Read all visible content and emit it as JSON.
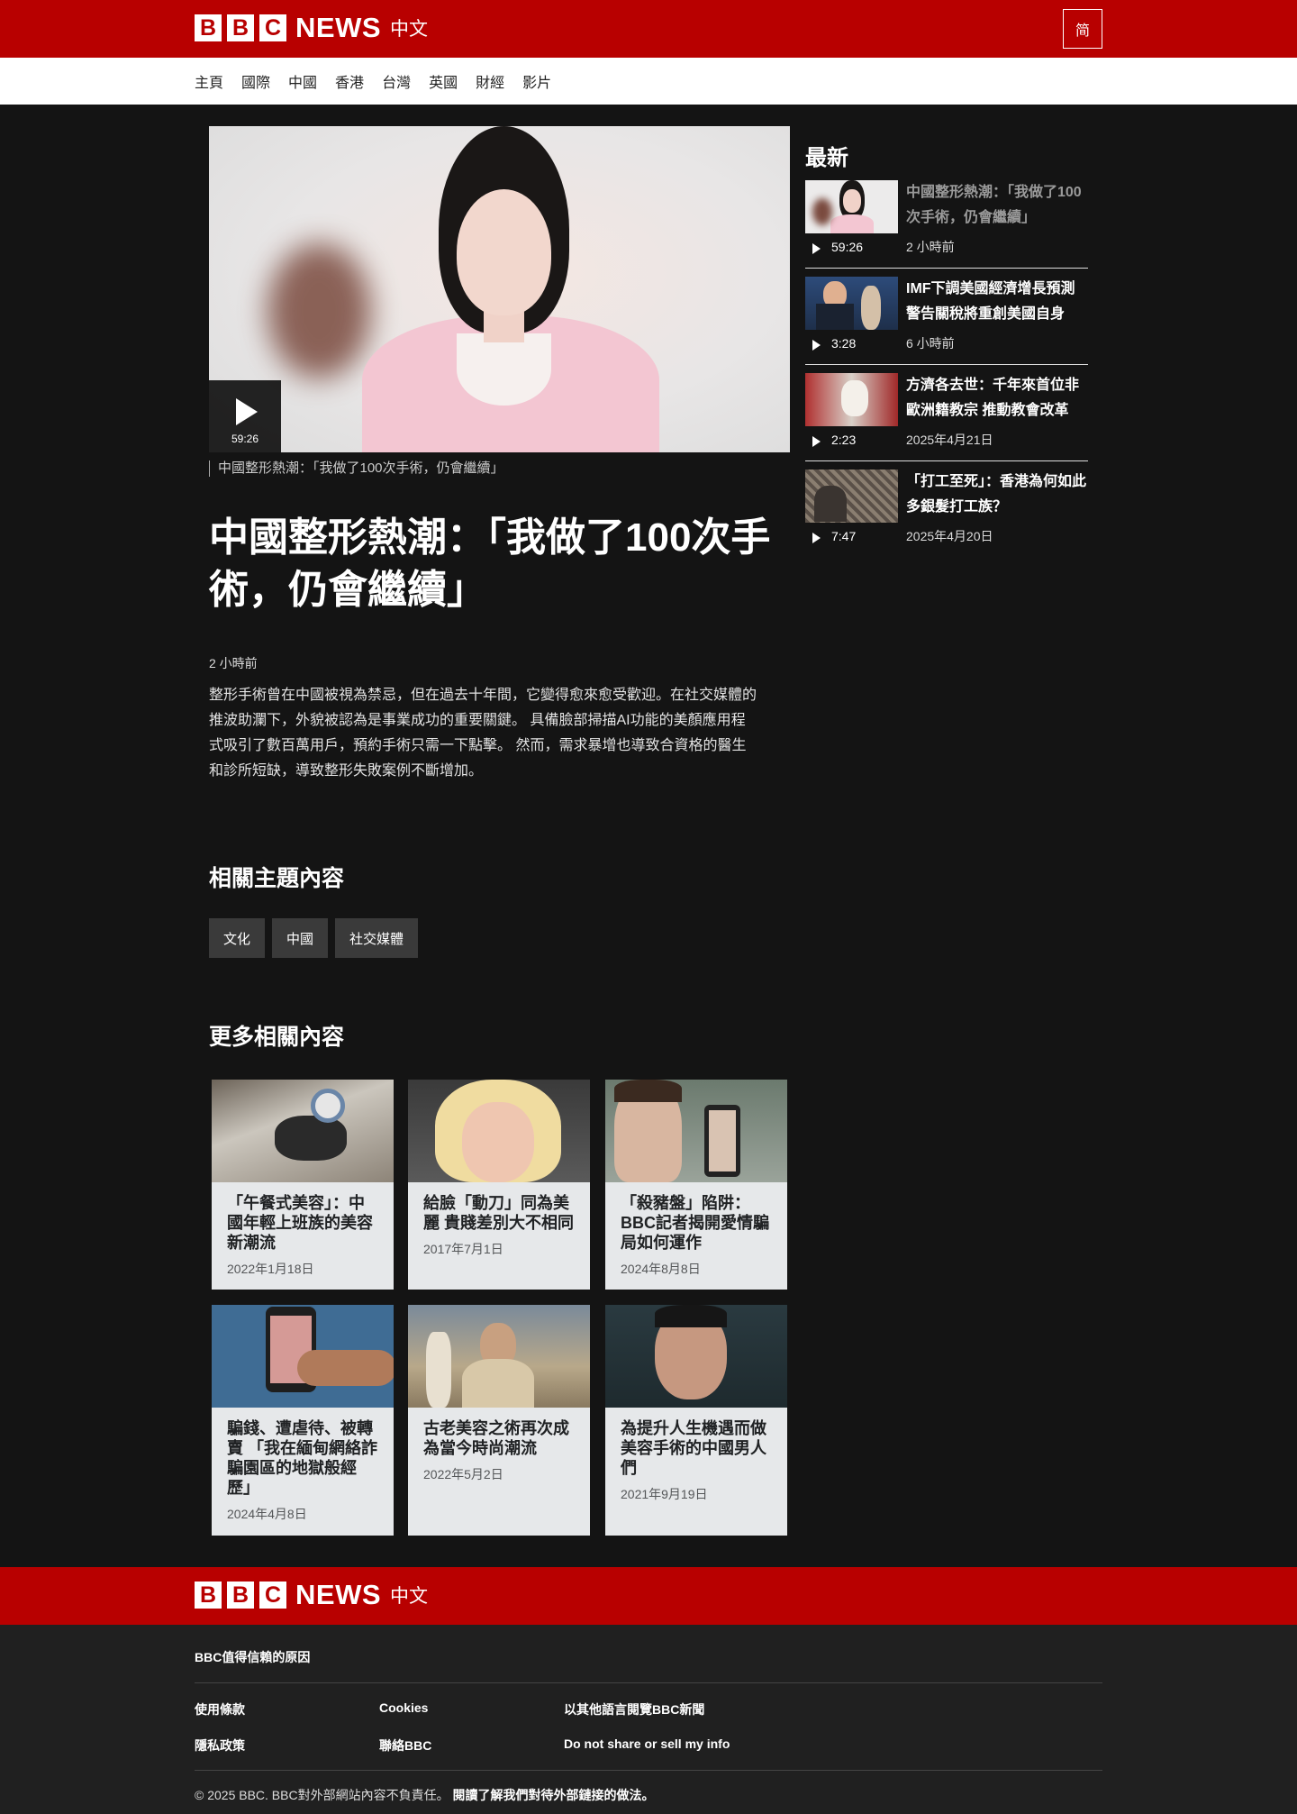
{
  "header": {
    "logo_letters": [
      "B",
      "B",
      "C"
    ],
    "logo_news": "NEWS",
    "logo_lang": "中文",
    "simplified_label": "简",
    "brand_color": "#b80000"
  },
  "nav": [
    "主頁",
    "國際",
    "中國",
    "香港",
    "台灣",
    "英國",
    "財經",
    "影片"
  ],
  "article": {
    "video_duration": "59:26",
    "caption": "中國整形熱潮：「我做了100次手術，仍會繼續」",
    "headline": "中國整形熱潮：「我做了100次手術，仍會繼續」",
    "time": "2 小時前",
    "summary": "整形手術曾在中國被視為禁忌，但在過去十年間，它變得愈來愈受歡迎。在社交媒體的推波助瀾下，外貌被認為是事業成功的重要關鍵。 具備臉部掃描AI功能的美顏應用程式吸引了數百萬用戶，預約手術只需一下點擊。 然而，需求暴增也導致合資格的醫生和診所短缺，導致整形失敗案例不斷增加。"
  },
  "latest": {
    "title": "最新",
    "items": [
      {
        "title": "中國整形熱潮：「我做了100次手術，仍會繼續」",
        "duration": "59:26",
        "time": "2 小時前"
      },
      {
        "title": "IMF下調美國經濟增長預測 警告關稅將重創美國自身",
        "duration": "3:28",
        "time": "6 小時前"
      },
      {
        "title": "方濟各去世：千年來首位非歐洲籍教宗 推動教會改革",
        "duration": "2:23",
        "time": "2025年4月21日"
      },
      {
        "title": "「打工至死」：香港為何如此多銀髮打工族？",
        "duration": "7:47",
        "time": "2025年4月20日"
      }
    ]
  },
  "related_topics": {
    "title": "相關主題內容",
    "tags": [
      "文化",
      "中國",
      "社交媒體"
    ]
  },
  "more": {
    "title": "更多相關內容",
    "cards": [
      {
        "title": "「午餐式美容」：中國年輕上班族的美容新潮流",
        "date": "2022年1月18日"
      },
      {
        "title": "給臉「動刀」同為美麗 貴賤差別大不相同",
        "date": "2017年7月1日"
      },
      {
        "title": "「殺豬盤」陷阱：BBC記者揭開愛情騙局如何運作",
        "date": "2024年8月8日"
      },
      {
        "title": "騙錢、遭虐待、被轉賣 「我在緬甸網絡詐騙園區的地獄般經歷」",
        "date": "2024年4月8日"
      },
      {
        "title": "古老美容之術再次成為當今時尚潮流",
        "date": "2022年5月2日"
      },
      {
        "title": "為提升人生機遇而做美容手術的中國男人們",
        "date": "2021年9月19日"
      }
    ]
  },
  "footer": {
    "why_trust": "BBC值得信賴的原因",
    "links": [
      "使用條款",
      "Cookies",
      "以其他語言閱覽BBC新聞",
      "隱私政策",
      "聯絡BBC",
      "Do not share or sell my info"
    ],
    "copyright": "© 2025 BBC. BBC對外部網站內容不負責任。",
    "external_link": "閱讀了解我們對待外部鏈接的做法。"
  }
}
